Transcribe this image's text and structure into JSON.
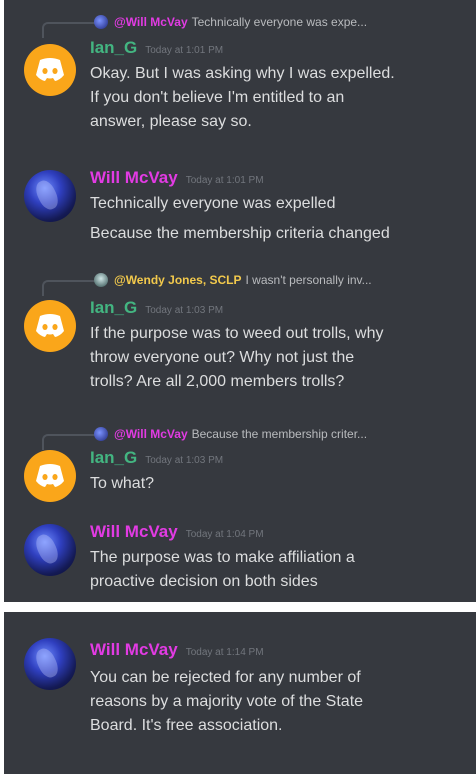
{
  "colors": {
    "background": "#36393f",
    "text": "#dcddde",
    "will_name": "#e23be3",
    "ian_name": "#43b581",
    "timestamp": "#72767d",
    "discord_avatar": "#faa61a"
  },
  "panel1": {
    "messages": [
      {
        "reply": {
          "name": "@Will McVay",
          "text": "Technically everyone was expe..."
        },
        "author": "Ian_G",
        "timestamp": "Today at 1:01 PM",
        "text": "Okay. But I was asking why I was expelled.\nIf you don't believe I'm entitled to an\nanswer, please say so."
      },
      {
        "author": "Will McVay",
        "timestamp": "Today at 1:01 PM",
        "lines": [
          "Technically everyone was expelled",
          "Because the membership criteria changed"
        ]
      },
      {
        "reply": {
          "name": "@Wendy Jones, SCLP",
          "text": "I wasn't personally inv..."
        },
        "author": "Ian_G",
        "timestamp": "Today at 1:03 PM",
        "text": "If the purpose was to weed out trolls, why\nthrow everyone out? Why not just the\ntrolls? Are all 2,000 members trolls?"
      },
      {
        "reply": {
          "name": "@Will McVay",
          "text": "Because the membership criter..."
        },
        "author": "Ian_G",
        "timestamp": "Today at 1:03 PM",
        "text": "To what?"
      },
      {
        "author": "Will McVay",
        "timestamp": "Today at 1:04 PM",
        "text": "The purpose was to make affiliation a\nproactive decision on both sides"
      }
    ]
  },
  "panel2": {
    "message": {
      "author": "Will McVay",
      "timestamp": "Today at 1:14 PM",
      "text": "You can be rejected for any number of\nreasons by a majority vote of the State\nBoard.  It's free association."
    }
  }
}
